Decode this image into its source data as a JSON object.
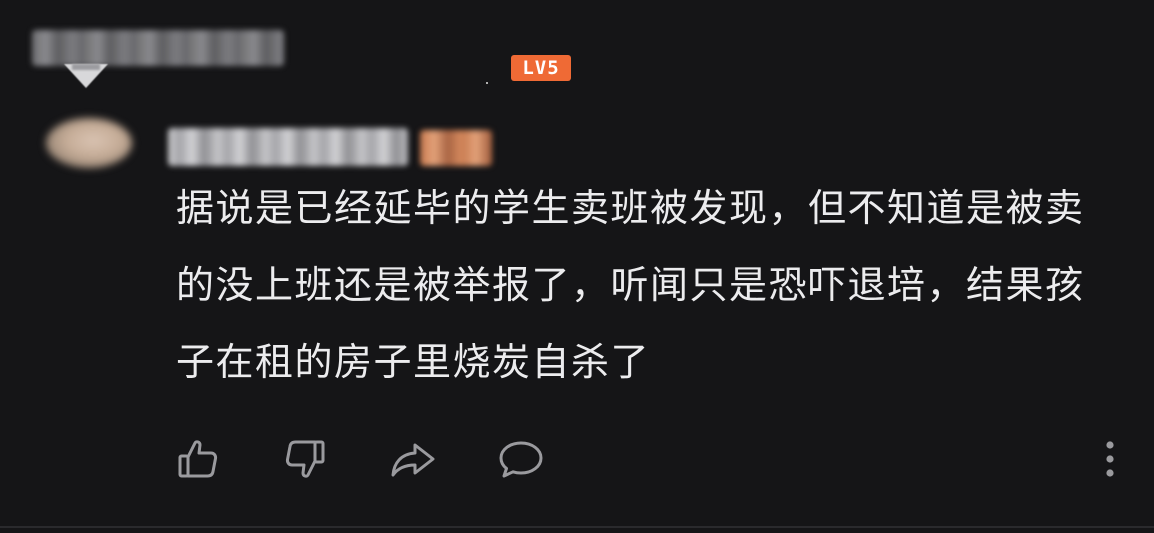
{
  "parent_comment": {
    "level_badge": "LV5"
  },
  "reply": {
    "text": "据说是已经延毕的学生卖班被发现，但不知道是被卖的没上班还是被举报了，听闻只是恐吓退培，结果孩子在租的房子里烧炭自杀了"
  },
  "actions": {
    "like_icon": "thumbs-up-icon",
    "dislike_icon": "thumbs-down-icon",
    "share_icon": "share-arrow-icon",
    "reply_icon": "speech-bubble-icon",
    "more_icon": "vertical-ellipsis-icon"
  },
  "colors": {
    "background": "#151517",
    "text": "#ececee",
    "icon": "#9a9a9e",
    "level_badge": "#ef6a35"
  }
}
